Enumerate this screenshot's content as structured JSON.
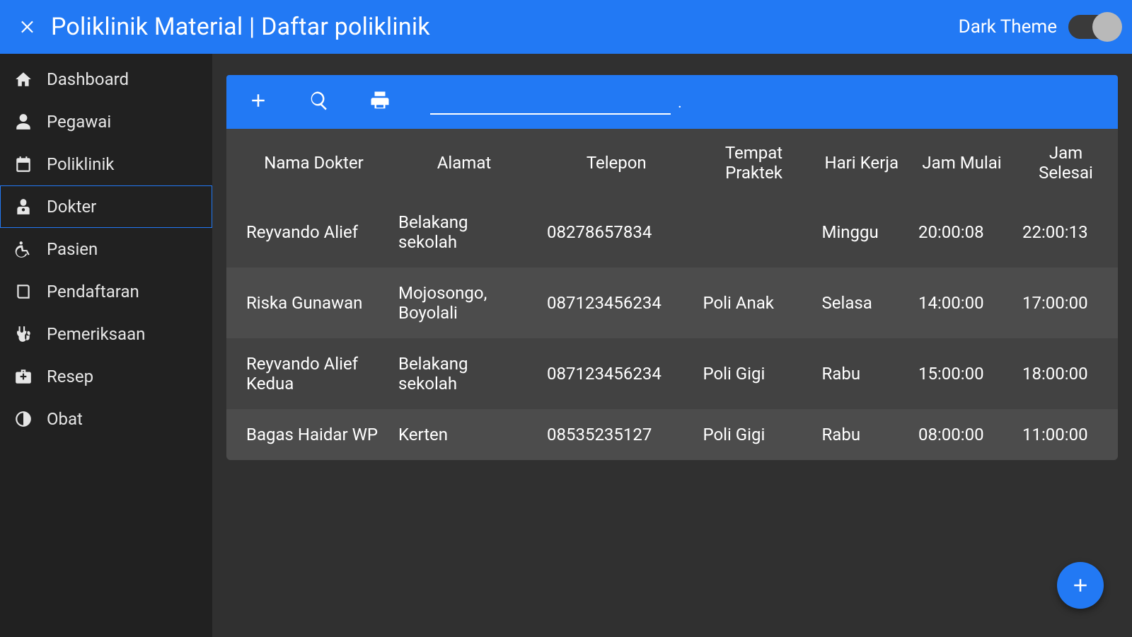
{
  "header": {
    "title": "Poliklinik Material | Daftar poliklinik",
    "theme_label": "Dark Theme"
  },
  "sidebar": {
    "items": [
      {
        "id": "dashboard",
        "label": "Dashboard",
        "icon": "home",
        "active": false
      },
      {
        "id": "pegawai",
        "label": "Pegawai",
        "icon": "user",
        "active": false
      },
      {
        "id": "poliklinik",
        "label": "Poliklinik",
        "icon": "calendar",
        "active": false
      },
      {
        "id": "dokter",
        "label": "Dokter",
        "icon": "doctor",
        "active": true
      },
      {
        "id": "pasien",
        "label": "Pasien",
        "icon": "wheelchair",
        "active": false
      },
      {
        "id": "pendaftaran",
        "label": "Pendaftaran",
        "icon": "book",
        "active": false
      },
      {
        "id": "pemeriksaan",
        "label": "Pemeriksaan",
        "icon": "stethoscope",
        "active": false
      },
      {
        "id": "resep",
        "label": "Resep",
        "icon": "medkit",
        "active": false
      },
      {
        "id": "obat",
        "label": "Obat",
        "icon": "contrast",
        "active": false
      }
    ]
  },
  "toolbar": {
    "add_icon": "plus",
    "search_icon": "search",
    "print_icon": "print",
    "search_value": "",
    "search_trailing": "."
  },
  "table": {
    "headers": {
      "nama": "Nama Dokter",
      "alamat": "Alamat",
      "telepon": "Telepon",
      "tempat": "Tempat Praktek",
      "hari": "Hari Kerja",
      "jam_mulai": "Jam Mulai",
      "jam_selesai": "Jam Selesai"
    },
    "rows": [
      {
        "nama": "Reyvando Alief",
        "alamat": "Belakang sekolah",
        "telepon": "08278657834",
        "tempat": "",
        "hari": "Minggu",
        "jam_mulai": "20:00:08",
        "jam_selesai": "22:00:13"
      },
      {
        "nama": "Riska Gunawan",
        "alamat": "Mojosongo, Boyolali",
        "telepon": "087123456234",
        "tempat": "Poli Anak",
        "hari": "Selasa",
        "jam_mulai": "14:00:00",
        "jam_selesai": "17:00:00"
      },
      {
        "nama": "Reyvando Alief Kedua",
        "alamat": "Belakang sekolah",
        "telepon": "087123456234",
        "tempat": "Poli Gigi",
        "hari": "Rabu",
        "jam_mulai": "15:00:00",
        "jam_selesai": "18:00:00"
      },
      {
        "nama": "Bagas Haidar WP",
        "alamat": "Kerten",
        "telepon": "08535235127",
        "tempat": "Poli Gigi",
        "hari": "Rabu",
        "jam_mulai": "08:00:00",
        "jam_selesai": "11:00:00"
      }
    ]
  },
  "fab": {
    "icon": "plus"
  }
}
